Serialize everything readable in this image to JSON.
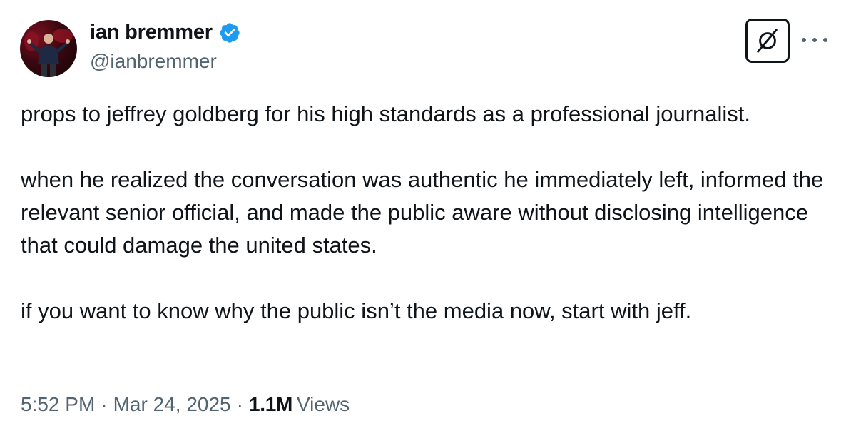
{
  "author": {
    "display_name": "ian bremmer",
    "handle": "@ianbremmer",
    "verified": true,
    "avatar_icon": "avatar-person-on-stage"
  },
  "actions": {
    "grok_icon": "grok-slash-circle-icon",
    "more_icon": "more-options-icon"
  },
  "tweet": {
    "paragraphs": [
      "props to jeffrey goldberg for his high standards as a professional journalist.",
      "when he realized the conversation was authentic he immediately left, informed the relevant senior official, and made the public aware without disclosing intelligence that could damage the united states.",
      "if you want to know why the public isn’t the media now, start with jeff."
    ]
  },
  "meta": {
    "time": "5:52 PM",
    "separator": "·",
    "date": "Mar 24, 2025",
    "views_count": "1.1M",
    "views_label": "Views"
  },
  "colors": {
    "text_primary": "#0f1419",
    "text_secondary": "#536471",
    "verified_blue": "#1d9bf0",
    "background": "#ffffff"
  }
}
